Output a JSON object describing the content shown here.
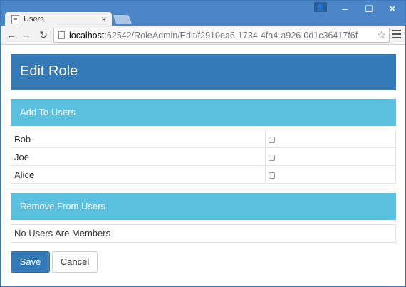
{
  "browser": {
    "tab_title": "Users",
    "tab_close": "×",
    "user_badge": "👤",
    "url_host": "localhost",
    "url_path": ":62542/RoleAdmin/Edit/f2910ea6-1734-4fa4-a926-0d1c36417f6f",
    "window_controls": {
      "minimize": "–",
      "maximize": "☐",
      "close": "✕"
    },
    "nav": {
      "back": "←",
      "forward": "→",
      "reload": "↻"
    },
    "star": "☆"
  },
  "page": {
    "title": "Edit Role",
    "add_section": {
      "heading": "Add To Users",
      "users": [
        {
          "name": "Bob",
          "checked": false
        },
        {
          "name": "Joe",
          "checked": false
        },
        {
          "name": "Alice",
          "checked": false
        }
      ]
    },
    "remove_section": {
      "heading": "Remove From Users",
      "empty_message": "No Users Are Members"
    },
    "buttons": {
      "save": "Save",
      "cancel": "Cancel"
    }
  },
  "colors": {
    "titlebar": "#4b87c7",
    "primary": "#337ab7",
    "info": "#5bc0de"
  }
}
